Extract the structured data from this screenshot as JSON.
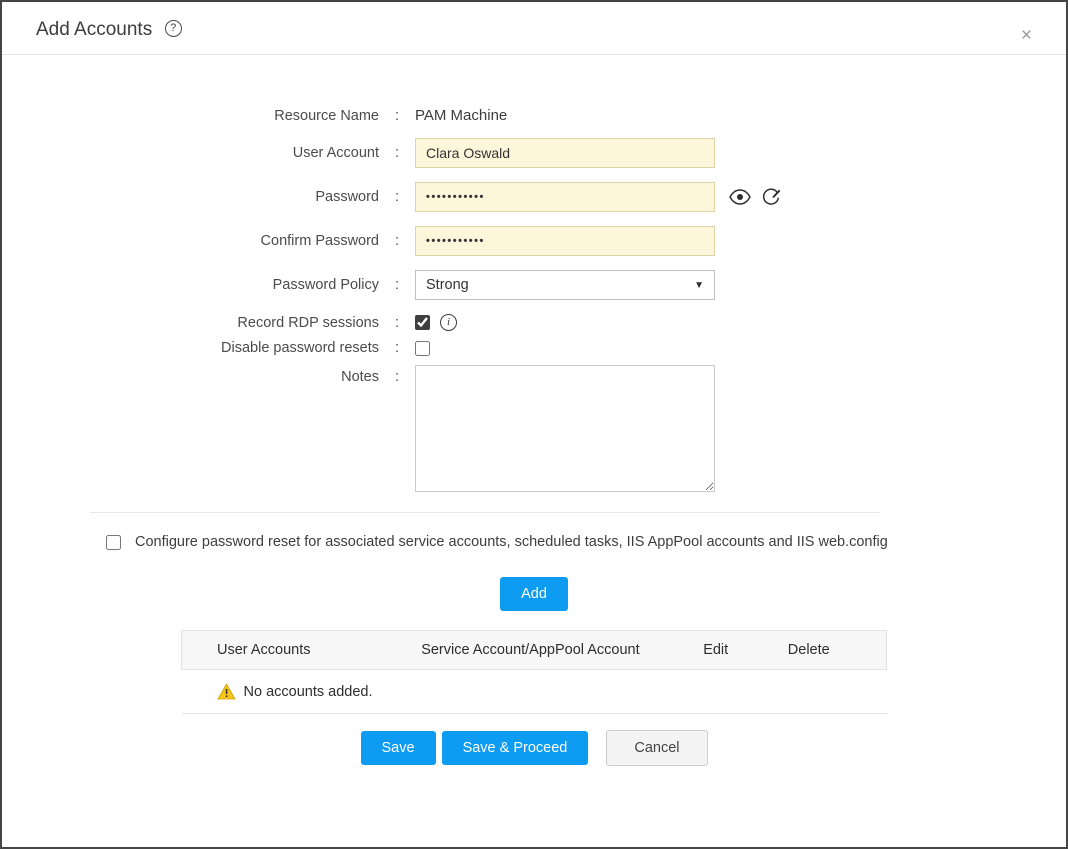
{
  "dialog": {
    "title": "Add Accounts",
    "close_glyph": "×",
    "help_glyph": "?"
  },
  "form": {
    "colon": ":",
    "resource_name": {
      "label": "Resource Name",
      "value": "PAM Machine"
    },
    "user_account": {
      "label": "User Account",
      "value": "Clara Oswald"
    },
    "password": {
      "label": "Password",
      "value": "•••••••••••"
    },
    "confirm_password": {
      "label": "Confirm Password",
      "value": "•••••••••••"
    },
    "password_policy": {
      "label": "Password Policy",
      "selected": "Strong",
      "caret": "▼"
    },
    "record_rdp": {
      "label": "Record RDP sessions",
      "checked": true,
      "info_glyph": "i"
    },
    "disable_resets": {
      "label": "Disable password resets",
      "checked": false
    },
    "notes": {
      "label": "Notes",
      "value": ""
    }
  },
  "configure_reset": {
    "label": "Configure password reset for associated service accounts, scheduled tasks, IIS AppPool accounts and IIS web.config",
    "checked": false
  },
  "buttons": {
    "add": "Add",
    "save": "Save",
    "save_and_proceed": "Save & Proceed",
    "cancel": "Cancel"
  },
  "table": {
    "headers": [
      "User Accounts",
      "Service Account/AppPool Account",
      "Edit",
      "Delete"
    ],
    "empty_message": "No accounts added."
  },
  "colors": {
    "accent_blue": "#0d9cf2",
    "input_background": "#fcf6da",
    "input_border": "#ded3a4",
    "warning_yellow": "#f2c500"
  }
}
